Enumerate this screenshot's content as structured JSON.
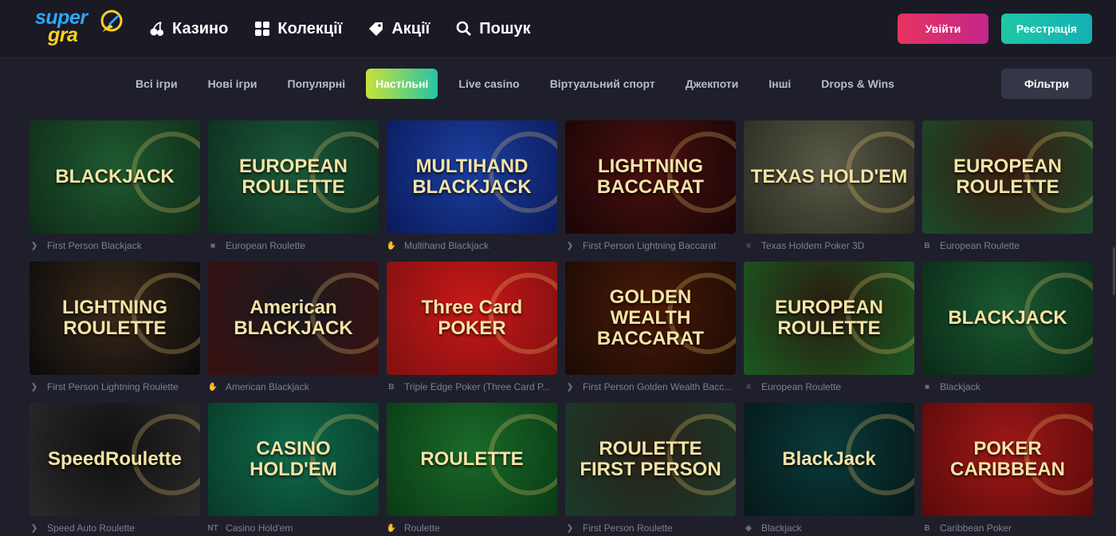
{
  "brand": {
    "line1": "super",
    "line2": "gra"
  },
  "nav": [
    {
      "label": "Казино",
      "icon": "cherry-icon"
    },
    {
      "label": "Колекції",
      "icon": "grid-icon"
    },
    {
      "label": "Акції",
      "icon": "tag-icon"
    },
    {
      "label": "Пошук",
      "icon": "search-icon"
    }
  ],
  "auth": {
    "login": "Увійти",
    "register": "Реєстрація"
  },
  "categories": [
    {
      "label": "Всі ігри",
      "active": false
    },
    {
      "label": "Нові ігри",
      "active": false
    },
    {
      "label": "Популярні",
      "active": false
    },
    {
      "label": "Настільні",
      "active": true
    },
    {
      "label": "Live casino",
      "active": false
    },
    {
      "label": "Віртуальний спорт",
      "active": false
    },
    {
      "label": "Джекпоти",
      "active": false
    },
    {
      "label": "Інші",
      "active": false
    },
    {
      "label": "Drops & Wins",
      "active": false
    }
  ],
  "filters_label": "Фільтри",
  "games": [
    {
      "name": "First Person Blackjack",
      "provider_icon": "play-icon",
      "art": "BLACKJACK",
      "bg": [
        "#1f5a30",
        "#0f2b18"
      ]
    },
    {
      "name": "European Roulette",
      "provider_icon": "square-icon",
      "art": "EUROPEAN ROULETTE",
      "bg": [
        "#1c5a3a",
        "#0c2c1d"
      ]
    },
    {
      "name": "Multihand Blackjack",
      "provider_icon": "hand-icon",
      "art": "MULTIHAND BLACKJACK",
      "bg": [
        "#1c3fa0",
        "#0a1a5a"
      ]
    },
    {
      "name": "First Person Lightning Baccarat",
      "provider_icon": "play-icon",
      "art": "LIGHTNING BACCARAT",
      "bg": [
        "#4a1010",
        "#1a0505"
      ]
    },
    {
      "name": "Texas Holdem Poker 3D",
      "provider_icon": "bars-icon",
      "art": "TEXAS HOLD'EM",
      "bg": [
        "#5a5a48",
        "#2a2a20"
      ]
    },
    {
      "name": "European Roulette",
      "provider_icon": "bs-icon",
      "art": "EUROPEAN ROULETTE",
      "bg": [
        "#3a1a10",
        "#1a4a2a"
      ]
    },
    {
      "name": "First Person Lightning Roulette",
      "provider_icon": "play-icon",
      "art": "LIGHTNING ROULETTE",
      "bg": [
        "#3a2a1a",
        "#0a0a0a"
      ]
    },
    {
      "name": "American Blackjack",
      "provider_icon": "hand-icon",
      "art": "American BLACKJACK",
      "bg": [
        "#1a1a20",
        "#3a1010"
      ]
    },
    {
      "name": "Triple Edge Poker (Three Card P...",
      "provider_icon": "bs-icon",
      "art": "Three Card POKER",
      "bg": [
        "#c81818",
        "#801010"
      ]
    },
    {
      "name": "First Person Golden Wealth Bacc...",
      "provider_icon": "play-icon",
      "art": "GOLDEN WEALTH BACCARAT",
      "bg": [
        "#4a1a08",
        "#1a0a04"
      ]
    },
    {
      "name": "European Roulette",
      "provider_icon": "bars-icon",
      "art": "EUROPEAN ROULETTE",
      "bg": [
        "#2a1a10",
        "#1a5a20"
      ]
    },
    {
      "name": "Blackjack",
      "provider_icon": "square-icon",
      "art": "BLACKJACK",
      "bg": [
        "#1a5a30",
        "#0a2a18"
      ]
    },
    {
      "name": "Speed Auto Roulette",
      "provider_icon": "play-icon",
      "art": "SpeedRoulette",
      "bg": [
        "#101010",
        "#2a2a2a"
      ]
    },
    {
      "name": "Casino Hold'em",
      "provider_icon": "nt-icon",
      "art": "CASINO HOLD'EM",
      "bg": [
        "#0f6a4a",
        "#083a28"
      ]
    },
    {
      "name": "Roulette",
      "provider_icon": "hand-icon",
      "art": "ROULETTE",
      "bg": [
        "#1a6a2a",
        "#0a3a14"
      ]
    },
    {
      "name": "First Person Roulette",
      "provider_icon": "play-icon",
      "art": "ROULETTE FIRST PERSON",
      "bg": [
        "#2a2018",
        "#1a3a2a"
      ]
    },
    {
      "name": "Blackjack",
      "provider_icon": "cube-icon",
      "art": "BlackJack",
      "bg": [
        "#0a3a3a",
        "#051818"
      ]
    },
    {
      "name": "Caribbean Poker",
      "provider_icon": "b-icon",
      "art": "POKER CARIBBEAN",
      "bg": [
        "#a01818",
        "#5a0a0a"
      ]
    }
  ],
  "colors": {
    "accent_login": "#e8335f",
    "accent_register": "#1ec8a5",
    "active_category": "#c8e23a"
  }
}
